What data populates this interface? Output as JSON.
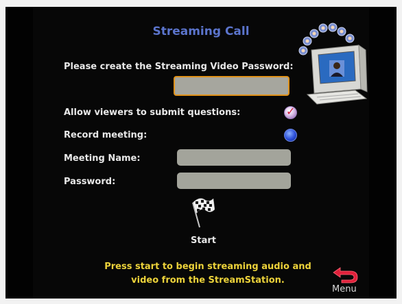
{
  "title": "Streaming Call",
  "password_prompt": "Please create the Streaming Video Password:",
  "password_value": "",
  "allow_questions": {
    "label": "Allow viewers to submit questions:",
    "checked": true
  },
  "record_meeting": {
    "label": "Record meeting:",
    "checked": false
  },
  "meeting_name": {
    "label": "Meeting Name:",
    "value": ""
  },
  "password": {
    "label": "Password:",
    "value": ""
  },
  "start": {
    "label": "Start"
  },
  "instruction_line1": "Press start to begin streaming audio and",
  "instruction_line2": "video from the StreamStation.",
  "menu": {
    "label": "Menu"
  },
  "colors": {
    "title": "#5b74cc",
    "text": "#e8e8e8",
    "instruction": "#ecd23a",
    "focus_border": "#e0921a",
    "field_fill": "#a3a49b",
    "menu_arrow": "#e0203a"
  }
}
